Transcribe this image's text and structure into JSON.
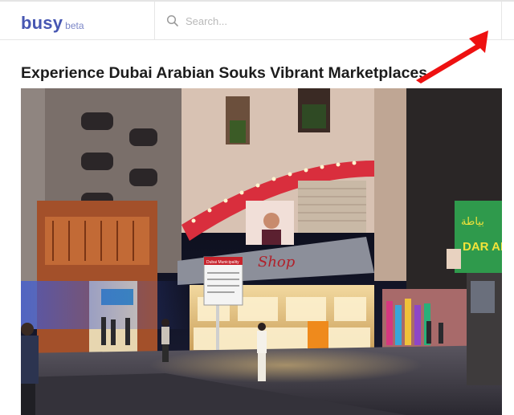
{
  "header": {
    "logo_text": "busy",
    "logo_badge": "beta",
    "search_placeholder": "Search..."
  },
  "post": {
    "title": "Experience Dubai Arabian Souks Vibrant Marketplaces"
  },
  "photo": {
    "sign_upper": "Dubai Municipality",
    "sign_lower": "DAR AL",
    "sign_arabic": "بياطة",
    "shop_logo": "Shop"
  },
  "colors": {
    "brand": "#4757b2",
    "annotation_arrow": "#ee1111"
  }
}
